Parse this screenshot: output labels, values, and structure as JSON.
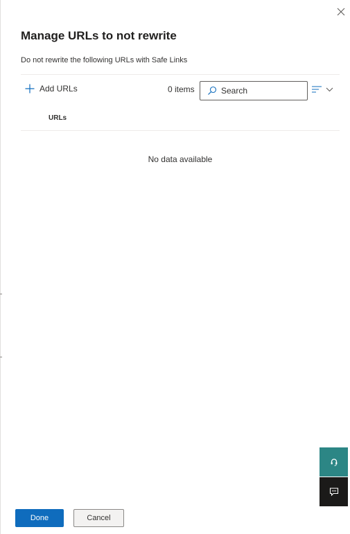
{
  "panel": {
    "title": "Manage URLs to not rewrite",
    "subtitle": "Do not rewrite the following URLs with Safe Links"
  },
  "toolbar": {
    "add_label": "Add URLs",
    "item_count": "0 items",
    "search_placeholder": "Search",
    "search_value": ""
  },
  "table": {
    "columns": [
      "URLs"
    ],
    "rows": [],
    "empty_message": "No data available"
  },
  "footer": {
    "done_label": "Done",
    "cancel_label": "Cancel"
  },
  "icons": {
    "close": "close-icon",
    "add": "plus-icon",
    "search": "search-icon",
    "filter": "filter-lines-icon",
    "chevron": "chevron-down-icon",
    "help": "headset-icon",
    "feedback": "feedback-chat-icon"
  },
  "colors": {
    "accent": "#0f6cbd",
    "help_fab": "#2c8685",
    "feedback_fab": "#1b1a19"
  }
}
